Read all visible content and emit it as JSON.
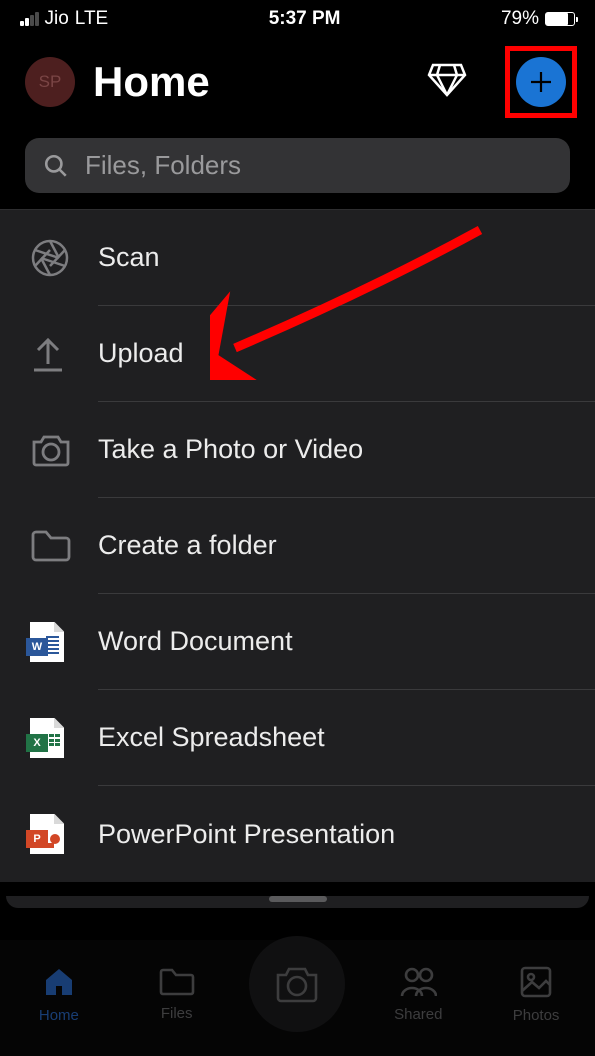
{
  "status": {
    "carrier": "Jio",
    "network": "LTE",
    "time": "5:37 PM",
    "battery_pct": "79%"
  },
  "header": {
    "avatar_initials": "SP",
    "title": "Home"
  },
  "search": {
    "placeholder": "Files, Folders"
  },
  "menu": {
    "items": [
      {
        "label": "Scan",
        "icon": "aperture-icon"
      },
      {
        "label": "Upload",
        "icon": "upload-icon"
      },
      {
        "label": "Take a Photo or Video",
        "icon": "camera-icon"
      },
      {
        "label": "Create a folder",
        "icon": "folder-icon"
      },
      {
        "label": "Word Document",
        "icon": "word-icon"
      },
      {
        "label": "Excel Spreadsheet",
        "icon": "excel-icon"
      },
      {
        "label": "PowerPoint Presentation",
        "icon": "powerpoint-icon"
      }
    ]
  },
  "tabbar": {
    "items": [
      {
        "label": "Home",
        "active": true
      },
      {
        "label": "Files",
        "active": false
      },
      {
        "label": "Shared",
        "active": false
      },
      {
        "label": "Photos",
        "active": false
      }
    ]
  },
  "colors": {
    "accent": "#1a74d4",
    "annotation": "#ff0000",
    "word": "#2b579a",
    "excel": "#217346",
    "powerpoint": "#d24726"
  }
}
